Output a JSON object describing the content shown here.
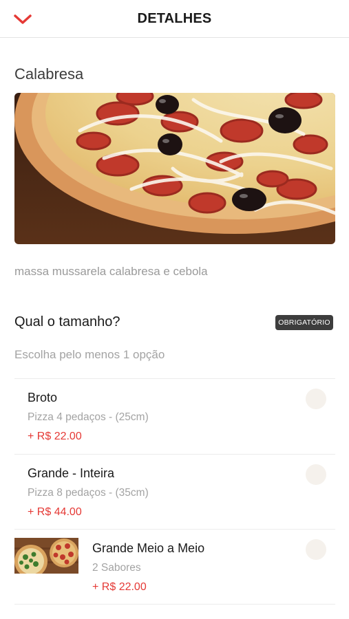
{
  "header": {
    "title": "DETALHES",
    "back_icon": "chevron-down-icon",
    "accent_color": "#e53935"
  },
  "product": {
    "name": "Calabresa",
    "image": "pizza-calabresa-photo",
    "description": "massa mussarela calabresa e cebola"
  },
  "size_group": {
    "title": "Qual o tamanho?",
    "badge": "OBRIGATÓRIO",
    "subtitle": "Escolha pelo menos 1 opção",
    "options": [
      {
        "name": "Broto",
        "description": "Pizza 4 pedaços - (25cm)",
        "price": "+ R$ 22.00",
        "selected": false
      },
      {
        "name": "Grande - Inteira",
        "description": "Pizza 8 pedaços - (35cm)",
        "price": "+ R$ 44.00",
        "selected": false
      },
      {
        "name": "Grande Meio a Meio",
        "description": "2 Sabores",
        "price": "+ R$ 22.00",
        "selected": false,
        "image": "two-pizzas-photo"
      }
    ]
  }
}
